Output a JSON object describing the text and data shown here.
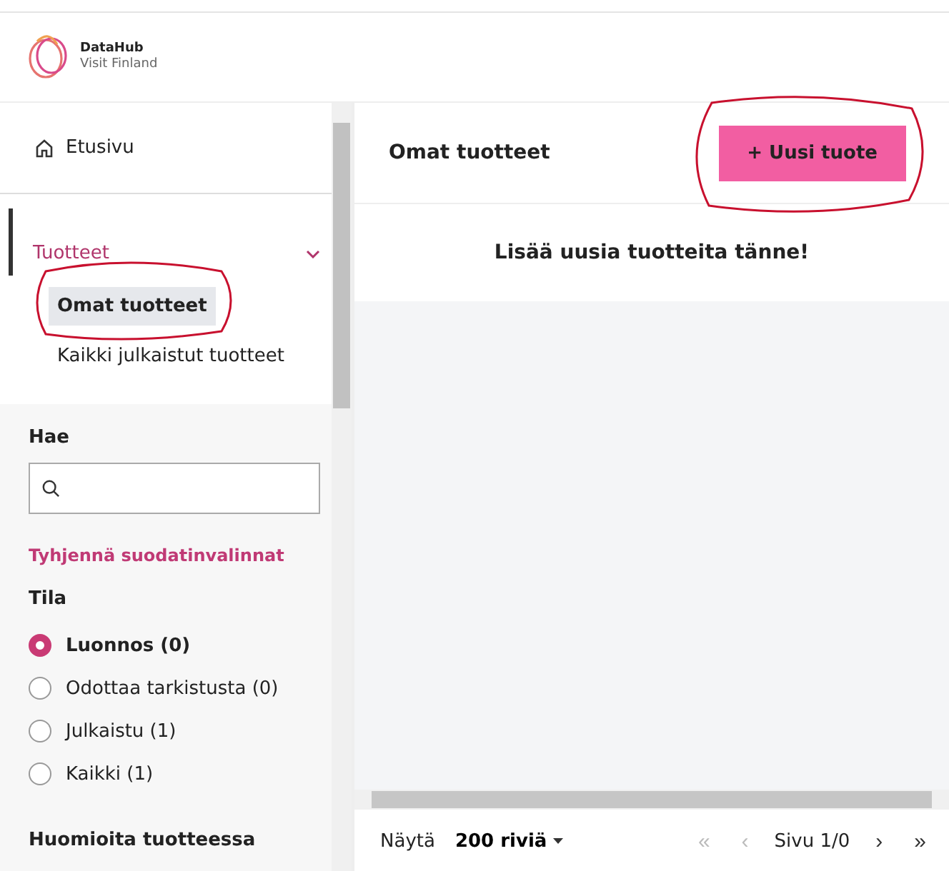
{
  "logo": {
    "line1": "DataHub",
    "line2": "Visit Finland"
  },
  "nav": {
    "home": "Etusivu",
    "section": {
      "label": "Tuotteet",
      "expanded": true,
      "items": [
        {
          "label": "Omat tuotteet",
          "selected": true
        },
        {
          "label": "Kaikki julkaistut tuotteet",
          "selected": false
        }
      ]
    }
  },
  "filters": {
    "search_label": "Hae",
    "clear": "Tyhjennä suodatinvalinnat",
    "status_label": "Tila",
    "statuses": [
      {
        "label": "Luonnos (0)",
        "selected": true
      },
      {
        "label": "Odottaa tarkistusta (0)",
        "selected": false
      },
      {
        "label": "Julkaistu (1)",
        "selected": false
      },
      {
        "label": "Kaikki (1)",
        "selected": false
      }
    ],
    "next_heading": "Huomioita tuotteessa"
  },
  "main": {
    "title": "Omat tuotteet",
    "new_button": "+ Uusi tuote",
    "empty_message": "Lisää uusia tuotteita tänne!"
  },
  "footer": {
    "show_label": "Näytä",
    "rows": "200 riviä",
    "page": "Sivu 1/0",
    "pager": [
      {
        "symbol": "«",
        "disabled": true
      },
      {
        "symbol": "‹",
        "disabled": true
      },
      {
        "symbol": "›",
        "disabled": false
      },
      {
        "symbol": "»",
        "disabled": false
      }
    ]
  }
}
